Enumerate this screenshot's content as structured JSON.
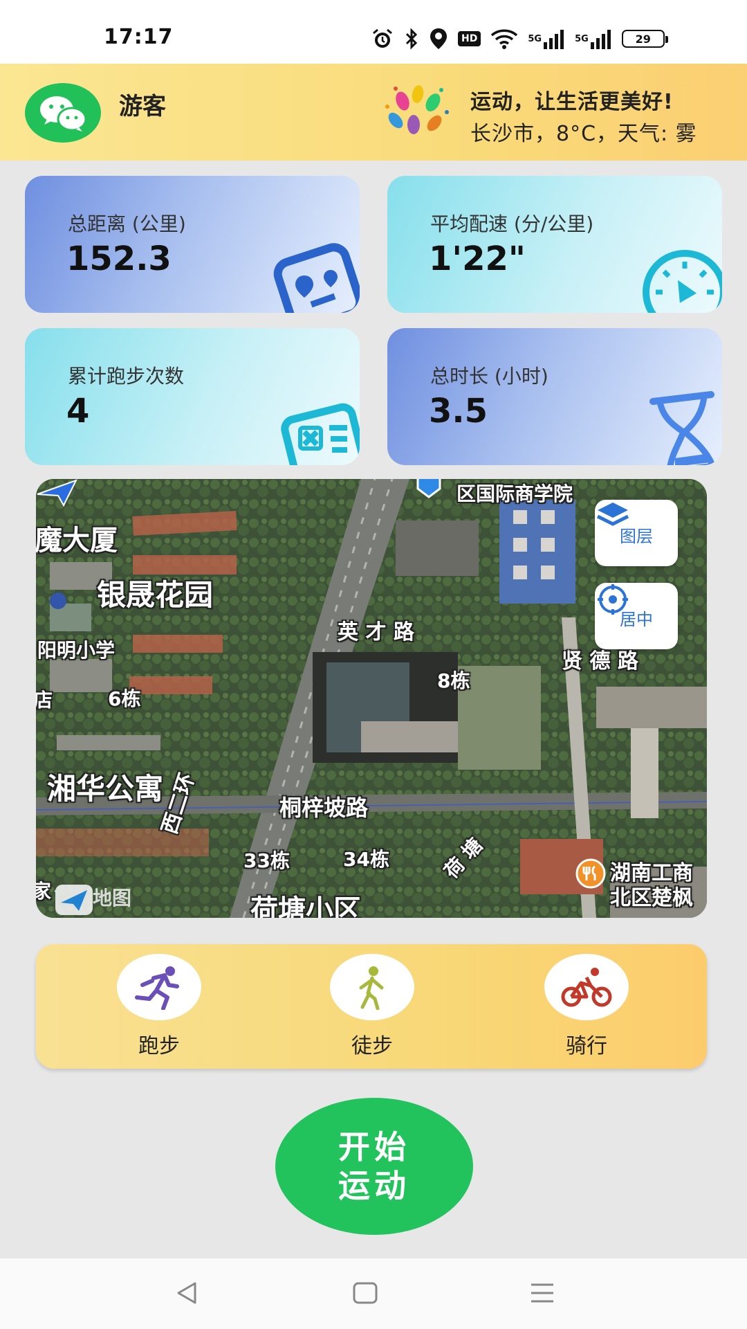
{
  "status_bar": {
    "time": "17:17",
    "network_1": "5G",
    "network_2": "5G",
    "hd_badge": "HD",
    "battery": "29",
    "icons": [
      "alarm-icon",
      "bluetooth-icon",
      "location-icon",
      "hd-icon",
      "wifi-icon",
      "signal-icon",
      "signal-icon",
      "battery-icon"
    ]
  },
  "header": {
    "user_name": "游客",
    "slogan": "运动，让生活更美好!",
    "weather": "长沙市，8°C，天气: 雾"
  },
  "stats": {
    "distance": {
      "label": "总距离 (公里)",
      "value": "152.3",
      "icon": "map-pin-icon"
    },
    "pace": {
      "label": "平均配速 (分/公里)",
      "value": "1'22\"",
      "icon": "speedometer-icon"
    },
    "count": {
      "label": "累计跑步次数",
      "value": "4",
      "icon": "id-card-icon"
    },
    "duration": {
      "label": "总时长 (小时)",
      "value": "3.5",
      "icon": "hourglass-icon"
    }
  },
  "map": {
    "layers_label": "图层",
    "center_label": "居中",
    "provider": "高德地图",
    "labels": {
      "a": "区国际商学院",
      "b": "魔大厦",
      "c": "银晟花园",
      "d": "阳明小学",
      "e": "6栋",
      "f": "英 才 路",
      "g": "8栋",
      "h": "贤 德 路",
      "i": "湘华公寓",
      "j": "桐梓坡路",
      "k": "33栋",
      "l": "34栋",
      "m": "西二环",
      "n": "荷塘小区",
      "o": "湖南工商",
      "p": "北区楚枫",
      "q": "荷 塘",
      "r": "店",
      "s": "家"
    }
  },
  "sports": [
    {
      "label": "跑步",
      "icon": "running-icon",
      "color": "#6a4fb8"
    },
    {
      "label": "徒步",
      "icon": "hiking-icon",
      "color": "#a8b83a"
    },
    {
      "label": "骑行",
      "icon": "cycling-icon",
      "color": "#c0392b"
    }
  ],
  "start_button": {
    "line1": "开始",
    "line2": "运动"
  },
  "colors": {
    "accent_green": "#22c35c",
    "header_yellow": "#f9db7a",
    "card_blue": "#6f8fe0",
    "card_cyan": "#86dfec",
    "map_button_blue": "#2c73d6"
  }
}
